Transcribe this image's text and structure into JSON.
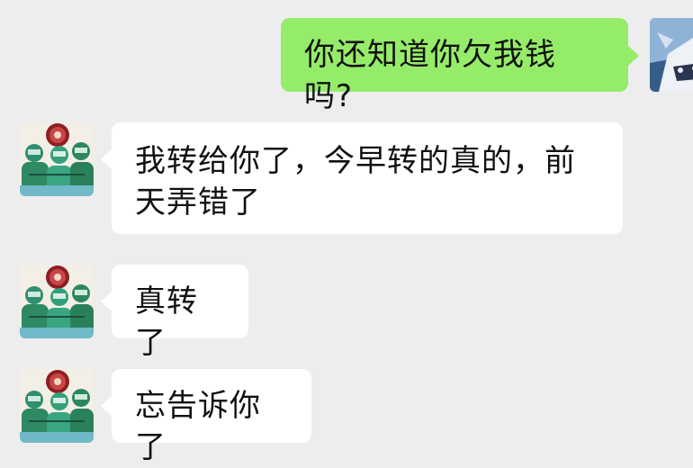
{
  "colors": {
    "background": "#ededed",
    "my_bubble": "#95ec69",
    "their_bubble": "#ffffff",
    "text": "#111111"
  },
  "messages": [
    {
      "sender": "me",
      "avatar_icon": "anime-character-avatar-icon",
      "text": "你还知道你欠我钱吗?"
    },
    {
      "sender": "other",
      "avatar_icon": "surgeons-cartoon-avatar-icon",
      "text": "我转给你了，今早转的真的，前天弄错了"
    },
    {
      "sender": "other",
      "avatar_icon": "surgeons-cartoon-avatar-icon",
      "text": "真转了"
    },
    {
      "sender": "other",
      "avatar_icon": "surgeons-cartoon-avatar-icon",
      "text": "忘告诉你了"
    }
  ]
}
